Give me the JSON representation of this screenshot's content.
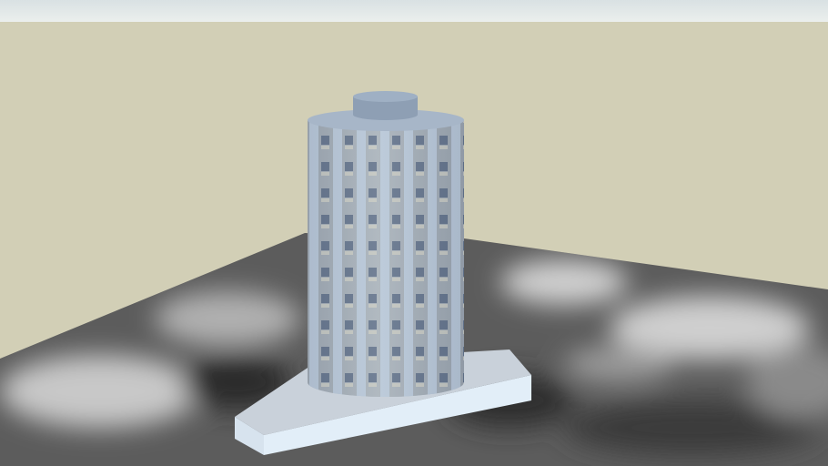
{
  "colors": {
    "sky": "#d2cfb6",
    "top_bar": "#e4eaea",
    "ground": "#5a5a5a",
    "building_wall": "#9fb0c4",
    "building_stripe": "#c4d2e0",
    "window": "#3e4d66",
    "base_top": "#c9d1da",
    "base_front": "#e2eef8",
    "cap": "#8e9fb4"
  }
}
